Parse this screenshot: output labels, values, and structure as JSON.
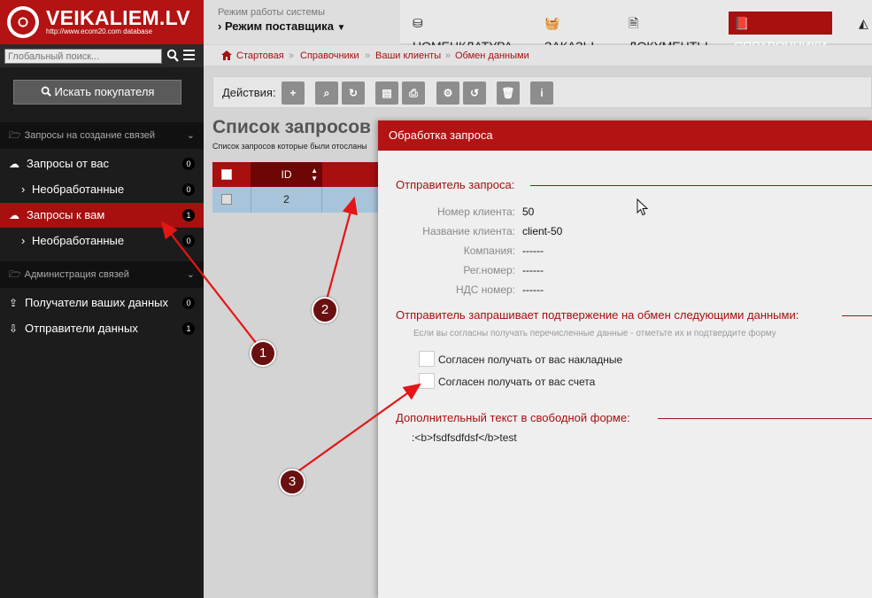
{
  "logo": {
    "title": "VEIKALIEM.LV",
    "subtitle": "http://www.ecom20.com database"
  },
  "sidebar": {
    "search_placeholder": "Глобальный поиск...",
    "find_button": "Искать покупателя",
    "section1": "Запросы на создание связей",
    "section2": "Администрация связей",
    "items": [
      {
        "label": "Запросы от вас",
        "badge": "0"
      },
      {
        "label": "Необработанные",
        "badge": "0"
      },
      {
        "label": "Запросы к вам",
        "badge": "1"
      },
      {
        "label": "Необработанные",
        "badge": "0"
      },
      {
        "label": "Получатели ваших данных",
        "badge": "0"
      },
      {
        "label": "Отправители данных",
        "badge": "1"
      }
    ]
  },
  "topbar": {
    "mode_label": "Режим работы системы",
    "mode_value": "› Режим поставщика",
    "nav": [
      "НОМЕНКЛАТУРА",
      "ЗАКАЗЫ",
      "ДОКУМЕНТЫ",
      "СПРАВОЧНИКИ"
    ]
  },
  "breadcrumb": [
    "Стартовая",
    "Справочники",
    "Ваши клиенты",
    "Обмен данными"
  ],
  "actions_label": "Действия:",
  "page": {
    "title": "Список запросов",
    "subtitle": "Список запросов которые были отосланы"
  },
  "table": {
    "col_id": "ID",
    "rows": [
      {
        "id": "2"
      }
    ]
  },
  "modal": {
    "title": "Обработка запроса",
    "sender_legend": "Отправитель запроса:",
    "fields": [
      {
        "label": "Номер клиента:",
        "value": "50"
      },
      {
        "label": "Название клиента:",
        "value": "client-50"
      },
      {
        "label": "Компания:",
        "value": "------"
      },
      {
        "label": "Рег.номер:",
        "value": "------"
      },
      {
        "label": "НДС номер:",
        "value": "------"
      }
    ],
    "confirm_legend": "Отправитель запрашивает подтвержение на обмен следующими данными:",
    "hint": "Если вы согласны получать перечисленные данные - отметьте их и подтвердите форму",
    "checkboxes": [
      "Согласен получать от вас накладные",
      "Согласен получать от вас счета"
    ],
    "free_legend": "Дополнительный текст в свободной форме:",
    "free_text": ":<b>fsdfsdfdsf</b>test"
  },
  "annotations": [
    "1",
    "2",
    "3"
  ],
  "colors": {
    "brand_red": "#b31313",
    "sidebar_bg": "#1c1c1c",
    "active_row": "#a7c4da"
  }
}
